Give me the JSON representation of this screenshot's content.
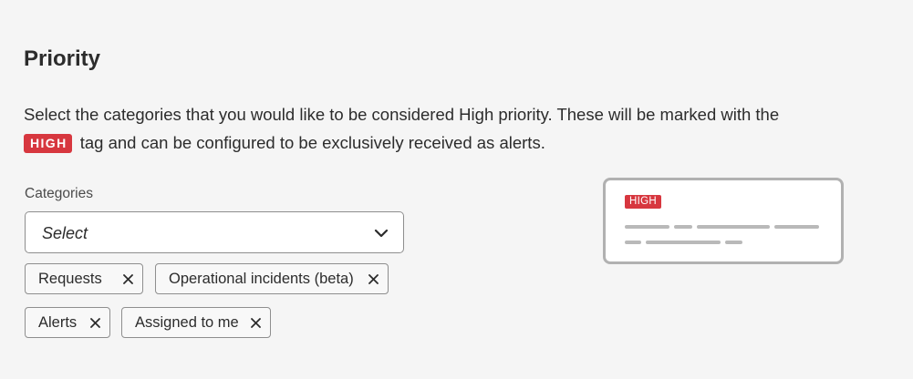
{
  "section": {
    "title": "Priority",
    "description_before": "Select the categories that you would like to be considered High priority. These will be marked with the",
    "badge_label": "HIGH",
    "description_after": "tag and can be configured to be exclusively received as alerts."
  },
  "categories": {
    "label": "Categories",
    "placeholder": "Select",
    "tags": [
      {
        "label": "Requests"
      },
      {
        "label": "Operational incidents (beta)"
      },
      {
        "label": "Alerts"
      },
      {
        "label": "Assigned to me"
      }
    ]
  },
  "preview": {
    "badge_label": "HIGH"
  },
  "colors": {
    "accent_high": "#d7373f",
    "background": "#f5f5f5",
    "border": "#8e8e8e",
    "preview_border": "#b1b1b1"
  },
  "icons": {
    "select": "chevron-down-icon",
    "tag_remove": "close-icon"
  }
}
